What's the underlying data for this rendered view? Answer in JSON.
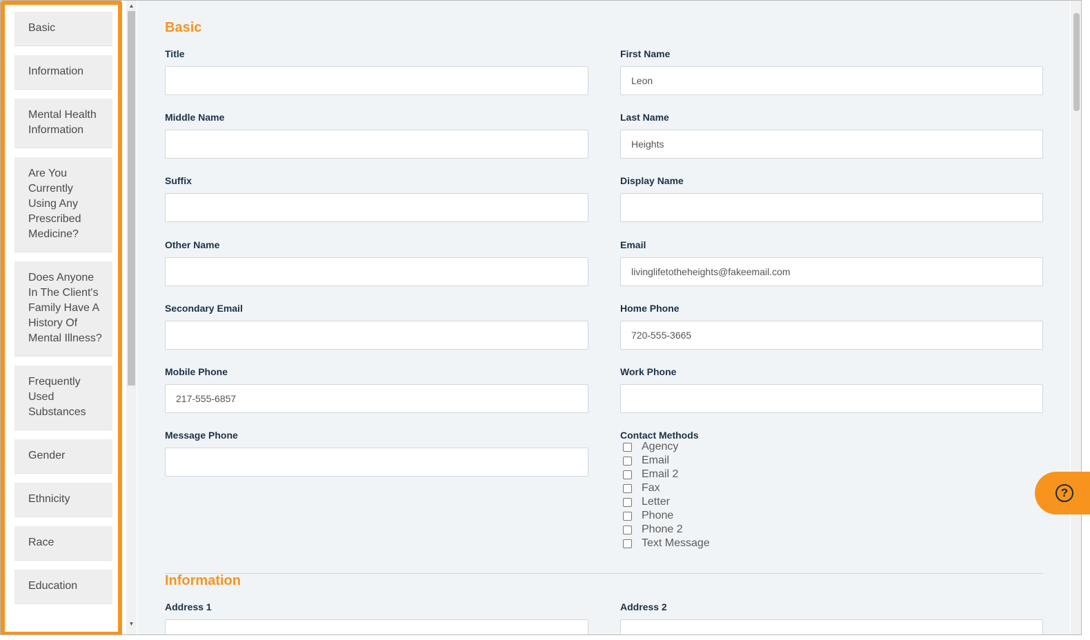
{
  "sidebar": {
    "items": [
      {
        "label": "Basic"
      },
      {
        "label": "Information"
      },
      {
        "label": "Mental Health Information"
      },
      {
        "label": "Are You Currently Using Any Prescribed Medicine?"
      },
      {
        "label": "Does Anyone In The Client's Family Have A History Of Mental Illness?"
      },
      {
        "label": "Frequently Used Substances"
      },
      {
        "label": "Gender"
      },
      {
        "label": "Ethnicity"
      },
      {
        "label": "Race"
      },
      {
        "label": "Education"
      }
    ]
  },
  "basic": {
    "title": "Basic",
    "fields": {
      "title": {
        "label": "Title",
        "value": ""
      },
      "first_name": {
        "label": "First Name",
        "value": "Leon"
      },
      "middle_name": {
        "label": "Middle Name",
        "value": ""
      },
      "last_name": {
        "label": "Last Name",
        "value": "Heights"
      },
      "suffix": {
        "label": "Suffix",
        "value": ""
      },
      "display_name": {
        "label": "Display Name",
        "value": ""
      },
      "other_name": {
        "label": "Other Name",
        "value": ""
      },
      "email": {
        "label": "Email",
        "value": "livinglifetotheheights@fakeemail.com"
      },
      "secondary_email": {
        "label": "Secondary Email",
        "value": ""
      },
      "home_phone": {
        "label": "Home Phone",
        "value": "720-555-3665"
      },
      "mobile_phone": {
        "label": "Mobile Phone",
        "value": "217-555-6857"
      },
      "work_phone": {
        "label": "Work Phone",
        "value": ""
      },
      "message_phone": {
        "label": "Message Phone",
        "value": ""
      }
    },
    "contact_methods": {
      "label": "Contact Methods",
      "options": [
        "Agency",
        "Email",
        "Email 2",
        "Fax",
        "Letter",
        "Phone",
        "Phone 2",
        "Text Message"
      ]
    }
  },
  "information": {
    "title": "Information",
    "fields": {
      "address1": {
        "label": "Address 1",
        "value": ""
      },
      "address2": {
        "label": "Address 2",
        "value": ""
      }
    }
  },
  "icons": {
    "help": "question-circle-icon",
    "scroll_up": "arrow-up-icon",
    "scroll_down": "arrow-down-icon"
  },
  "colors": {
    "accent": "#f7941d",
    "label": "#1c3147",
    "background": "#f0f4f7"
  }
}
